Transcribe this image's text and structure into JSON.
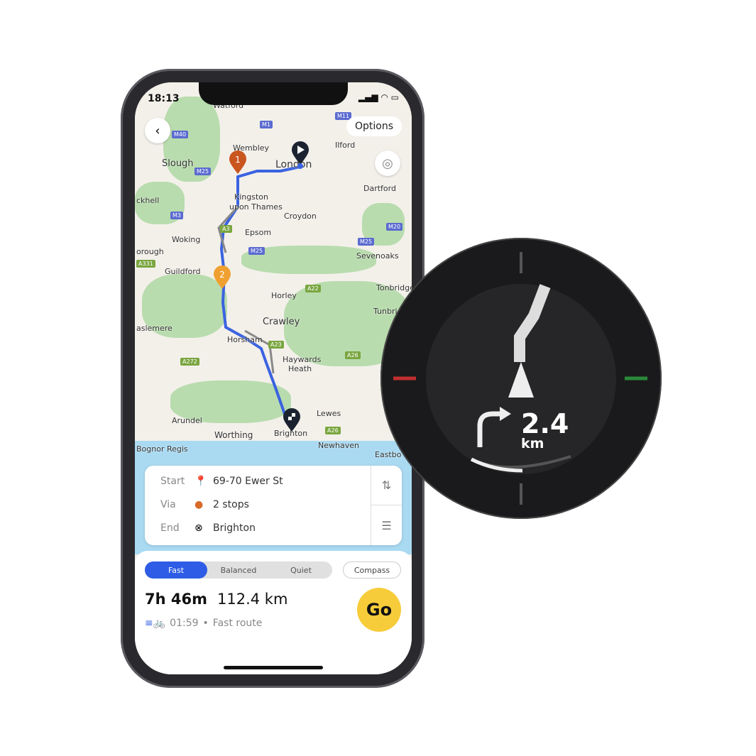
{
  "status_bar": {
    "time": "18:13"
  },
  "header": {
    "options_label": "Options"
  },
  "map": {
    "places": [
      "Watford",
      "Wembley",
      "Slough",
      "London",
      "Ilford",
      "Dartford",
      "Kingston",
      "upon Thames",
      "Croydon",
      "Woking",
      "Epsom",
      "Sevenoaks",
      "Guildford",
      "Horley",
      "Tonbridge",
      "Crawley",
      "Horsham",
      "Haywards",
      "Heath",
      "Lewes",
      "Arundel",
      "Worthing",
      "Brighton",
      "Newhaven",
      "Bognor Regis",
      "Eastbo",
      "aslemere",
      "orough",
      "ckhell",
      "Tunbri"
    ],
    "roads": [
      "M40",
      "M1",
      "M11",
      "M25",
      "M3",
      "A3",
      "M25",
      "M25",
      "M20",
      "A22",
      "A23",
      "A26",
      "A272",
      "A26",
      "A331"
    ],
    "markers": {
      "stop1": "1",
      "stop2": "2"
    },
    "colors": {
      "route": "#3b63e0",
      "stop1": "#c9551f",
      "stop2": "#f0a030"
    }
  },
  "route_card": {
    "start_label": "Start",
    "start_value": "69-70 Ewer St",
    "via_label": "Via",
    "via_value": "2 stops",
    "end_label": "End",
    "end_value": "Brighton"
  },
  "sheet": {
    "modes": [
      "Fast",
      "Balanced",
      "Quiet"
    ],
    "selected_mode": "Fast",
    "compass_label": "Compass",
    "duration": "7h 46m",
    "distance": "112.4 km",
    "eta": "01:59",
    "route_type": "Fast route",
    "go_label": "Go"
  },
  "device": {
    "distance": "2.4",
    "unit": "km"
  }
}
